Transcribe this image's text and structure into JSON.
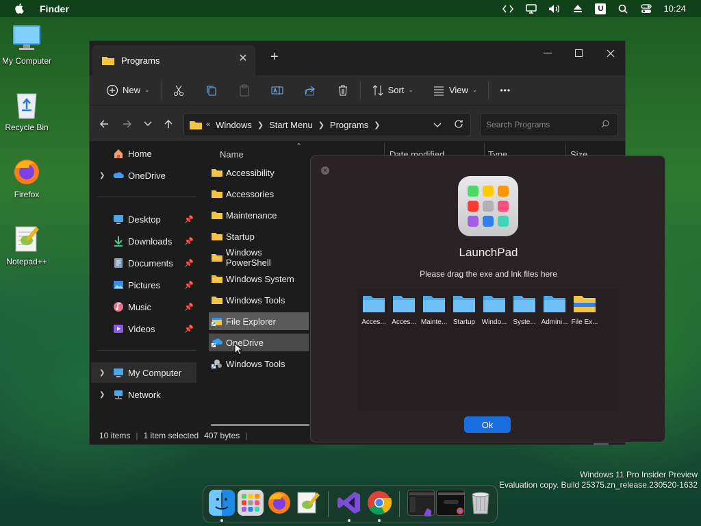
{
  "menubar": {
    "app": "Finder",
    "time": "10:24",
    "u_label": "U"
  },
  "desktop": {
    "icons": [
      {
        "label": "My Computer"
      },
      {
        "label": "Recycle Bin"
      },
      {
        "label": "Firefox"
      },
      {
        "label": "Notepad++"
      }
    ]
  },
  "explorer": {
    "tab_title": "Programs",
    "toolbar": {
      "new": "New",
      "sort": "Sort",
      "view": "View",
      "more": "•••"
    },
    "address": {
      "prefix": "«",
      "crumbs": [
        "Windows",
        "Start Menu",
        "Programs"
      ]
    },
    "search_placeholder": "Search Programs",
    "sidebar": {
      "home": "Home",
      "onedrive": "OneDrive",
      "desktop": "Desktop",
      "downloads": "Downloads",
      "documents": "Documents",
      "pictures": "Pictures",
      "music": "Music",
      "videos": "Videos",
      "my_computer": "My Computer",
      "network": "Network"
    },
    "columns": {
      "name": "Name",
      "date": "Date modified",
      "type": "Type",
      "size": "Size"
    },
    "files": [
      {
        "name": "Accessibility",
        "kind": "folder"
      },
      {
        "name": "Accessories",
        "kind": "folder"
      },
      {
        "name": "Maintenance",
        "kind": "folder"
      },
      {
        "name": "Startup",
        "kind": "folder"
      },
      {
        "name": "Windows PowerShell",
        "kind": "folder"
      },
      {
        "name": "Windows System",
        "kind": "folder"
      },
      {
        "name": "Windows Tools",
        "kind": "folder"
      },
      {
        "name": "File Explorer",
        "kind": "shortcut"
      },
      {
        "name": "OneDrive",
        "kind": "shortcut"
      },
      {
        "name": "Windows Tools",
        "kind": "shortcut"
      }
    ],
    "status": {
      "items": "10 items",
      "selected": "1 item selected",
      "bytes": "407 bytes"
    }
  },
  "launchpad": {
    "title": "LaunchPad",
    "subtitle": "Please drag the exe and lnk files here",
    "files": [
      "Acces...",
      "Acces...",
      "Mainte...",
      "Startup",
      "Windo...",
      "Syste...",
      "Admini...",
      "File Ex..."
    ],
    "ok": "Ok"
  },
  "watermark": {
    "line1": "Windows 11 Pro Insider Preview",
    "line2": "Evaluation copy. Build 25375.zn_release.230520-1632"
  },
  "colors": {
    "accent": "#1a6fe0",
    "folder": "#f4c542",
    "lp_folder": "#4fa8e8"
  }
}
